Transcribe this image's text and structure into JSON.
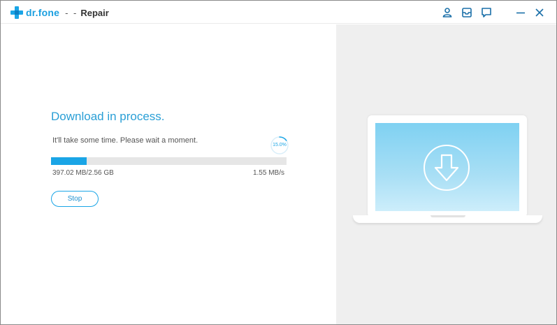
{
  "app": {
    "brand": "dr.fone",
    "separator": "- -",
    "module": "Repair"
  },
  "download": {
    "heading": "Download in process.",
    "message": "It'll take some time. Please wait a moment.",
    "percent_label": "15.0%",
    "progress": 0.15,
    "size_text": "397.02 MB/2.56 GB",
    "speed_text": "1.55 MB/s",
    "stop_label": "Stop"
  },
  "titlebar_icons": [
    "user-icon",
    "archive-icon",
    "feedback-icon",
    "minimize-icon",
    "close-icon"
  ],
  "colors": {
    "accent": "#1aa5e6",
    "heading": "#2a9fd6",
    "track": "#e6e6e6",
    "right_bg": "#efefef",
    "screen_top": "#7fd1f2",
    "screen_bottom": "#cdeefb"
  }
}
